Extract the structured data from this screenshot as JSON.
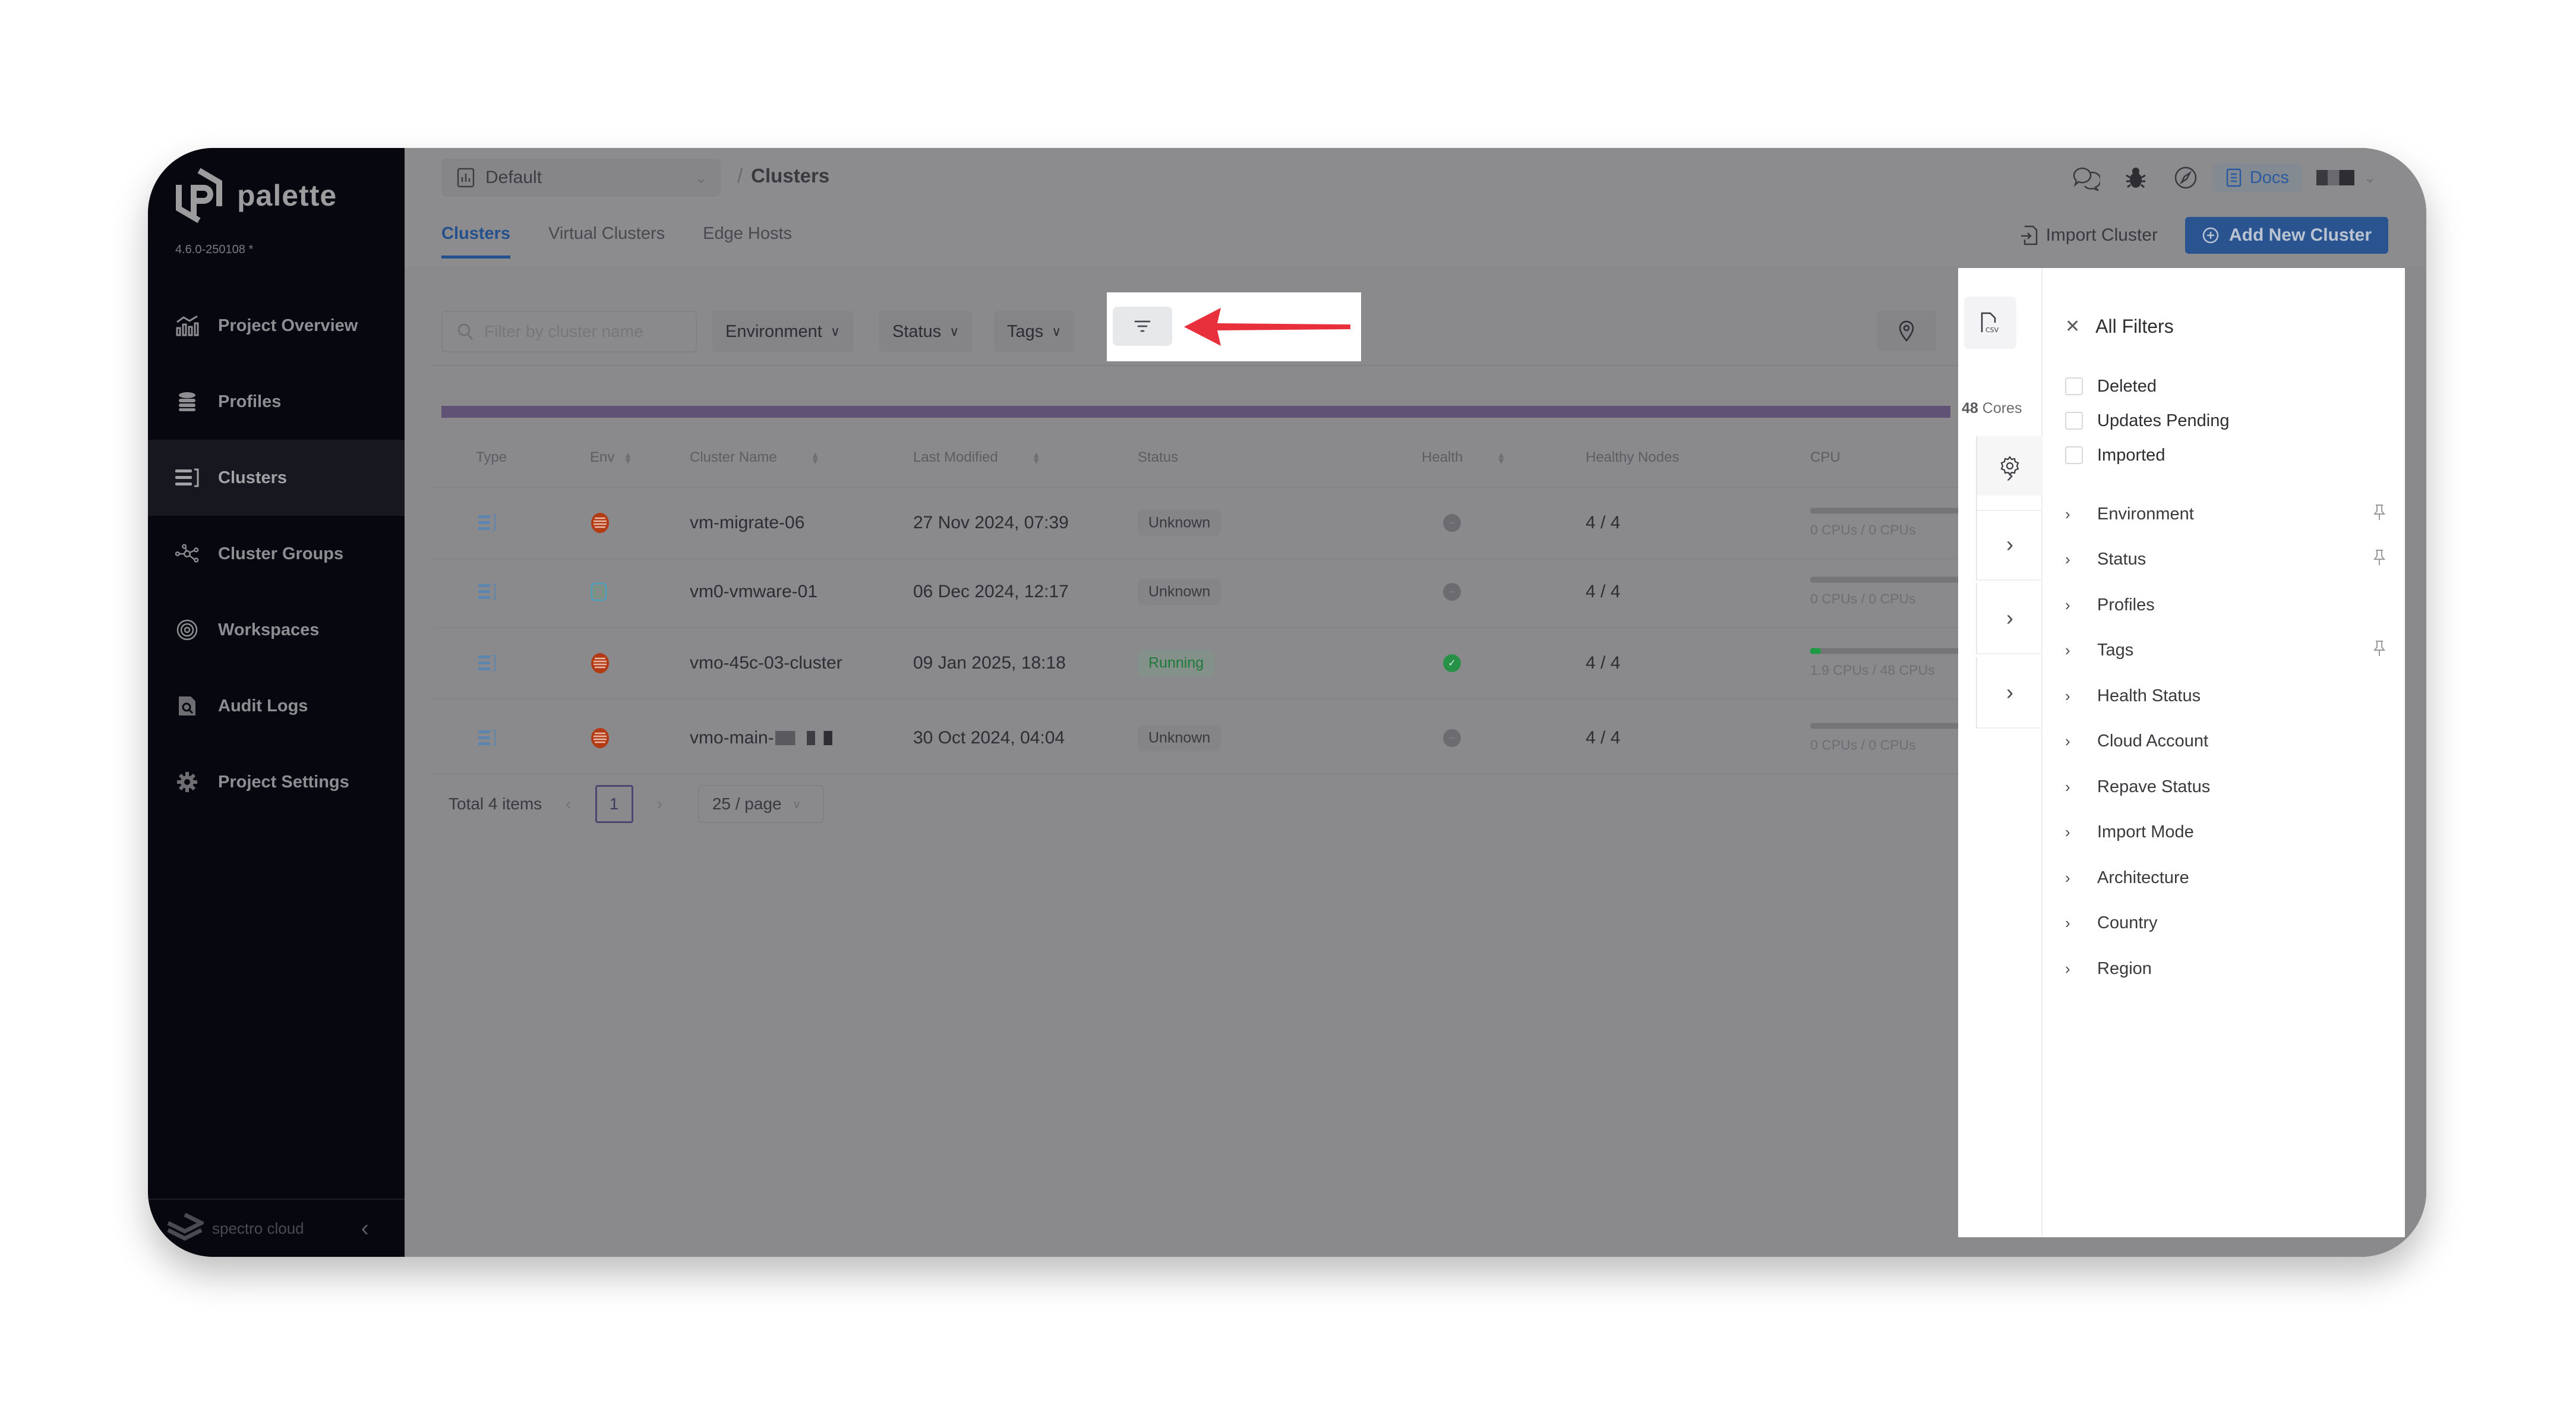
{
  "app": {
    "name": "palette",
    "version": "4.6.0-250108 *",
    "footer_brand": "spectro cloud"
  },
  "sidebar": {
    "items": [
      {
        "label": "Project Overview",
        "icon": "chart-icon",
        "active": false
      },
      {
        "label": "Profiles",
        "icon": "stack-icon",
        "active": false
      },
      {
        "label": "Clusters",
        "icon": "clusters-icon",
        "active": true
      },
      {
        "label": "Cluster Groups",
        "icon": "network-icon",
        "active": false
      },
      {
        "label": "Workspaces",
        "icon": "target-icon",
        "active": false
      },
      {
        "label": "Audit Logs",
        "icon": "audit-icon",
        "active": false
      },
      {
        "label": "Project Settings",
        "icon": "gear-icon",
        "active": false
      }
    ]
  },
  "header": {
    "project": "Default",
    "breadcrumb_sep": "/",
    "breadcrumb": "Clusters",
    "docs_label": "Docs",
    "tabs": [
      {
        "label": "Clusters",
        "active": true
      },
      {
        "label": "Virtual Clusters",
        "active": false
      },
      {
        "label": "Edge Hosts",
        "active": false
      }
    ],
    "import_label": "Import Cluster",
    "add_label": "Add New Cluster"
  },
  "filters": {
    "search_placeholder": "Filter by cluster name",
    "dropdowns": [
      "Environment",
      "Status",
      "Tags"
    ]
  },
  "summary": {
    "cores_value": "48",
    "cores_unit": "Cores"
  },
  "table": {
    "columns": [
      "Type",
      "Env",
      "Cluster Name",
      "Last Modified",
      "Status",
      "Health",
      "Healthy Nodes",
      "CPU"
    ],
    "rows": [
      {
        "name": "vm-migrate-06",
        "env": "openshift",
        "modified": "27 Nov 2024, 07:39",
        "status": "Unknown",
        "health": "unknown",
        "nodes": "4 / 4",
        "cpu": "0 CPUs / 0 CPUs",
        "cpu_fraction": 0
      },
      {
        "name": "vm0-vmware-01",
        "env": "vmware",
        "modified": "06 Dec 2024, 12:17",
        "status": "Unknown",
        "health": "unknown",
        "nodes": "4 / 4",
        "cpu": "0 CPUs / 0 CPUs",
        "cpu_fraction": 0
      },
      {
        "name": "vmo-45c-03-cluster",
        "env": "openshift",
        "modified": "09 Jan 2025, 18:18",
        "status": "Running",
        "health": "healthy",
        "nodes": "4 / 4",
        "cpu": "1.9 CPUs / 48 CPUs",
        "cpu_fraction": 0.04
      },
      {
        "name": "vmo-main-",
        "env": "openshift",
        "modified": "30 Oct 2024, 04:04",
        "status": "Unknown",
        "health": "unknown",
        "nodes": "4 / 4",
        "cpu": "0 CPUs / 0 CPUs",
        "cpu_fraction": 0
      }
    ]
  },
  "pagination": {
    "total": "Total 4 items",
    "current_page": "1",
    "page_size": "25 / page"
  },
  "drawer": {
    "title": "All Filters",
    "checkboxes": [
      {
        "label": "Deleted",
        "checked": false
      },
      {
        "label": "Updates Pending",
        "checked": false
      },
      {
        "label": "Imported",
        "checked": false
      }
    ],
    "groups": [
      {
        "label": "Environment",
        "pinned": true
      },
      {
        "label": "Status",
        "pinned": true
      },
      {
        "label": "Profiles",
        "pinned": false
      },
      {
        "label": "Tags",
        "pinned": true
      },
      {
        "label": "Health Status",
        "pinned": false
      },
      {
        "label": "Cloud Account",
        "pinned": false
      },
      {
        "label": "Repave Status",
        "pinned": false
      },
      {
        "label": "Import Mode",
        "pinned": false
      },
      {
        "label": "Architecture",
        "pinned": false
      },
      {
        "label": "Country",
        "pinned": false
      },
      {
        "label": "Region",
        "pinned": false
      }
    ]
  },
  "colors": {
    "accent": "#2a5490",
    "running": "#1f7a3a",
    "annotation_arrow": "#e8303c",
    "openshift": "#c0401a"
  }
}
